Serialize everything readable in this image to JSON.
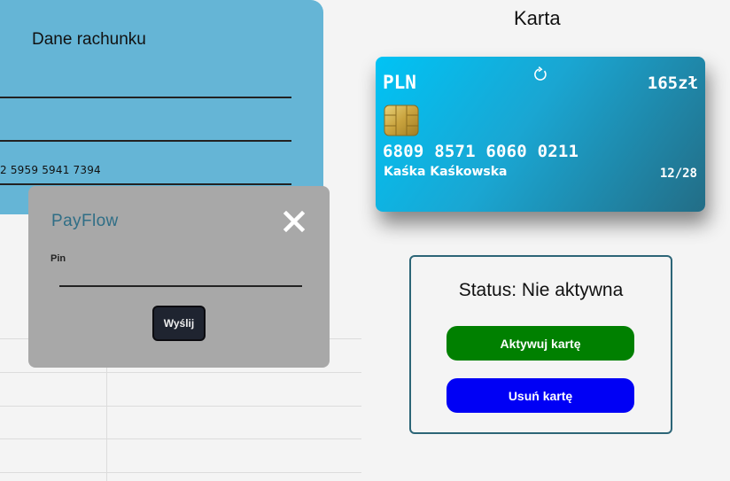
{
  "account": {
    "title": "Dane rachunku",
    "number_fragment": "2 5959 5941 7394"
  },
  "pin_modal": {
    "logo": "PayFlow",
    "close_icon": "close-icon",
    "pin_label": "Pin",
    "pin_value": "",
    "send_label": "Wyślij"
  },
  "card_section": {
    "heading": "Karta",
    "currency": "PLN",
    "balance": "165zł",
    "refresh_icon": "refresh-icon",
    "chip_icon": "chip-icon",
    "number": "6809 8571 6060 0211",
    "holder": "Kaśka Kaśkowska",
    "expiry": "12/28",
    "colors": {
      "gradient_start": "#00c3f5",
      "gradient_end": "#236d86"
    }
  },
  "status": {
    "text": "Status: Nie aktywna",
    "activate_label": "Aktywuj kartę",
    "delete_label": "Usuń kartę",
    "colors": {
      "activate": "#008000",
      "delete": "#0000f5"
    }
  }
}
